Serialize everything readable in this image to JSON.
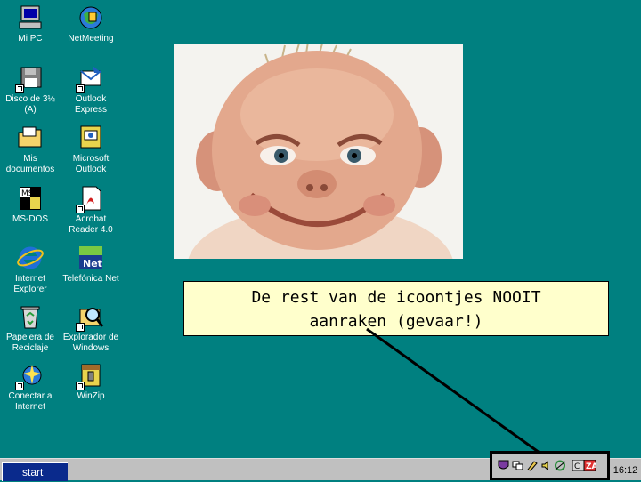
{
  "desktop_icons": [
    {
      "label_lines": [
        "Mi PC"
      ],
      "icon": "my-computer-icon"
    },
    {
      "label_lines": [
        "NetMeeting"
      ],
      "icon": "netmeeting-icon"
    },
    {
      "label_lines": [
        "Disco de 3½",
        "(A)"
      ],
      "icon": "floppy-disk-icon"
    },
    {
      "label_lines": [
        "Outlook",
        "Express"
      ],
      "icon": "outlook-express-icon"
    },
    {
      "label_lines": [
        "Mis",
        "documentos"
      ],
      "icon": "my-documents-folder-icon"
    },
    {
      "label_lines": [
        "Microsoft",
        "Outlook"
      ],
      "icon": "microsoft-outlook-icon"
    },
    {
      "label_lines": [
        "MS-DOS"
      ],
      "icon": "ms-dos-icon"
    },
    {
      "label_lines": [
        "Acrobat",
        "Reader 4.0"
      ],
      "icon": "acrobat-reader-icon"
    },
    {
      "label_lines": [
        "Internet",
        "Explorer"
      ],
      "icon": "internet-explorer-icon"
    },
    {
      "label_lines": [
        "Telefónica Net"
      ],
      "icon": "telefonica-net-icon"
    },
    {
      "label_lines": [
        "Papelera de",
        "Reciclaje"
      ],
      "icon": "recycle-bin-icon"
    },
    {
      "label_lines": [
        "Explorador de",
        "Windows"
      ],
      "icon": "windows-explorer-icon"
    },
    {
      "label_lines": [
        "Conectar a",
        "Internet"
      ],
      "icon": "connect-to-internet-icon"
    },
    {
      "label_lines": [
        "WinZip"
      ],
      "icon": "winzip-icon"
    }
  ],
  "callout": {
    "line1": "De rest van de icoontjes NOOIT",
    "line2": "aanraken (gevaar!)"
  },
  "taskbar": {
    "start_label": "start",
    "clock": "16:12",
    "tray_icons": [
      "shield-icon",
      "network-icon",
      "pencil-icon",
      "speaker-icon",
      "connection-icon",
      "zonealarm-icon"
    ]
  },
  "colors": {
    "desktop": "#008080",
    "taskbar": "#c0c0c0",
    "start_button": "#0a2a8c",
    "callout_bg": "#ffffcc"
  }
}
